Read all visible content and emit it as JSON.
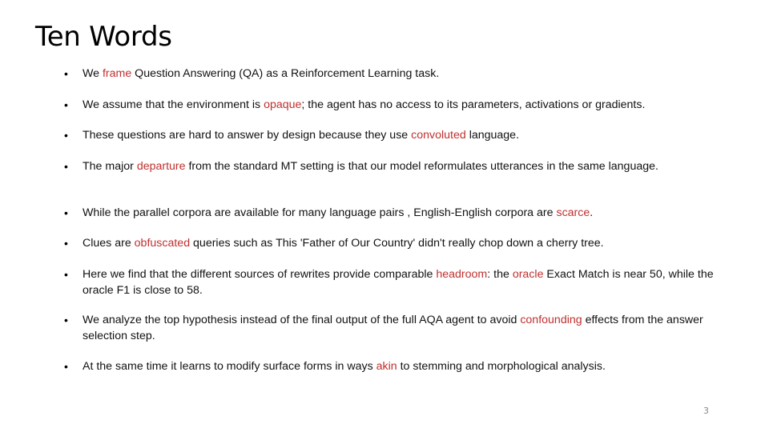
{
  "slide": {
    "title": "Ten Words",
    "page_number": "3",
    "accent_color": "#c0302f",
    "bullets": [
      {
        "before": "We ",
        "highlight": "frame",
        "after": " Question Answering (QA) as a Reinforcement Learning task."
      },
      {
        "before": "We assume that the environment is ",
        "highlight": "opaque",
        "after": "; the agent has no access to its parameters, activations or gradients."
      },
      {
        "before": "These questions are hard to answer by design because they use ",
        "highlight": "convoluted",
        "after": " language."
      },
      {
        "before": "The major ",
        "highlight": "departure",
        "after": " from the standard MT setting is that our  model reformulates utterances in the same language."
      },
      {
        "before": "While the parallel corpora are available for many language pairs , English-English corpora are ",
        "highlight": "scarce",
        "after": "."
      },
      {
        "before": "Clues are ",
        "highlight": "obfuscated",
        "after": " queries such as This 'Father of Our Country' didn't really chop down a cherry tree."
      },
      {
        "before": "Here we find that the different sources of rewrites provide comparable ",
        "highlight": "headroom",
        "middle": ": the ",
        "highlight2": "oracle",
        "after": " Exact Match is near 50, while the oracle F1 is close to 58."
      },
      {
        "before": "We analyze the top hypothesis instead of the final output of the full AQA agent to avoid ",
        "highlight": "confounding",
        "after": " effects from the answer selection step."
      },
      {
        "before": "At the same time it learns to modify surface forms in ways ",
        "highlight": "akin",
        "after": " to stemming and morphological analysis."
      }
    ]
  }
}
